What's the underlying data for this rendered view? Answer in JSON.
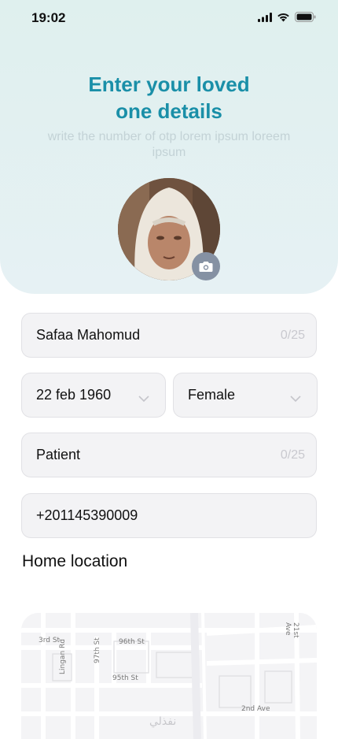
{
  "status_bar": {
    "time": "19:02"
  },
  "header": {
    "title_line1": "Enter your loved",
    "title_line2": "one details",
    "subtitle": "write the number of otp lorem ipsum loreem ipsum"
  },
  "form": {
    "name": {
      "value": "Safaa Mahomud",
      "counter": "0/25"
    },
    "birthdate": {
      "value": "22 feb 1960"
    },
    "gender": {
      "value": "Female"
    },
    "relation": {
      "value": "Patient",
      "counter": "0/25"
    },
    "phone": {
      "value": "+201145390009"
    }
  },
  "location": {
    "title": "Home location",
    "streets": [
      "3rd St",
      "Lingan Rd",
      "97th St",
      "96th St",
      "95th St",
      "21st Ave",
      "2nd Ave"
    ]
  },
  "watermark": "نفذلي",
  "colors": {
    "accent": "#1a8fa8",
    "header_bg": "#e2f0f1",
    "camera": "#8591a3"
  }
}
